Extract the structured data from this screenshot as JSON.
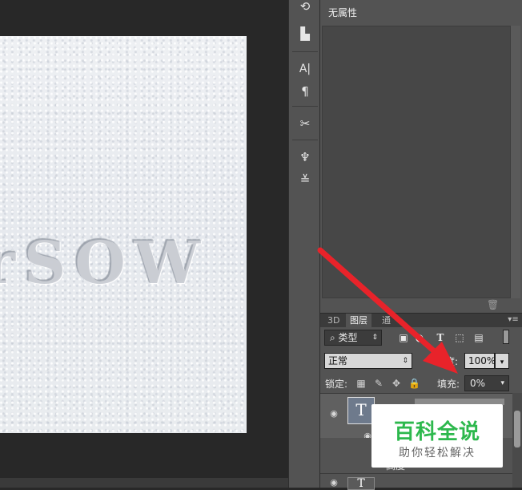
{
  "canvas": {
    "snow_text": "rSOW"
  },
  "tools": [
    {
      "icon": "history-icon",
      "glyph": "⟲"
    },
    {
      "icon": "clone-source-icon",
      "glyph": "▙"
    },
    {
      "icon": "character-icon",
      "glyph": "A|"
    },
    {
      "icon": "paragraph-icon",
      "glyph": "¶"
    },
    {
      "icon": "tool-presets-icon",
      "glyph": "✂"
    },
    {
      "icon": "brush-presets-icon",
      "glyph": "♆"
    },
    {
      "icon": "brush-settings-icon",
      "glyph": "≚"
    }
  ],
  "properties": {
    "title": "无属性"
  },
  "tabs": {
    "t3d": "3D",
    "layers": "图层",
    "channels": "通"
  },
  "layers": {
    "filter_kind": "类型",
    "blend_mode": "正常",
    "opacity_label": "不透明度:",
    "opacity_label_visible": "度:",
    "opacity_value": "100%",
    "lock_label": "锁定:",
    "fill_label": "填充:",
    "fill_value": "0%",
    "partial_label": "高度"
  },
  "watermark": {
    "title": "百科全说",
    "subtitle": "助你轻松解决"
  },
  "colors": {
    "arrow": "#e8232a",
    "watermark_green": "#2db84d"
  }
}
